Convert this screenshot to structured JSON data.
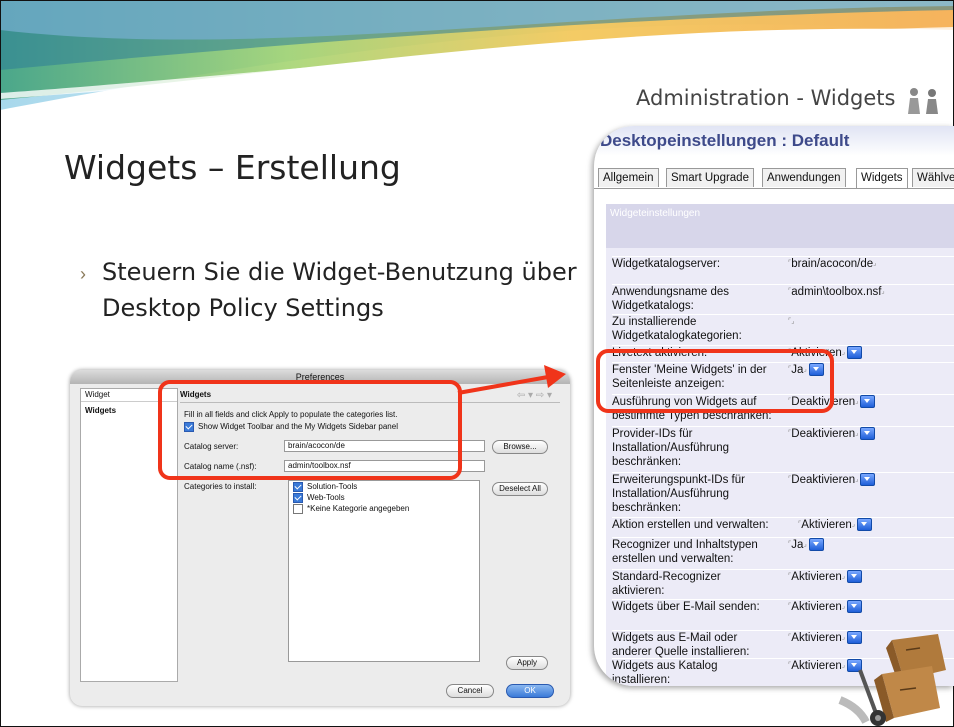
{
  "header": {
    "section_title": "Administration - Widgets",
    "people_icon": "people-icon"
  },
  "slide": {
    "title": "Widgets – Erstellung",
    "bullet": "Steuern Sie die Widget-Benutzung über Desktop Policy Settings"
  },
  "preferences": {
    "window_title": "Preferences",
    "left_header": "Widget",
    "left_item": "Widgets",
    "panel_title": "Widgets",
    "instructions": "Fill in all fields and click Apply to populate the categories list.",
    "show_toolbar_label": "Show Widget Toolbar and the My Widgets Sidebar panel",
    "show_toolbar_checked": true,
    "catalog_server_label": "Catalog server:",
    "catalog_server_value": "brain/acocon/de",
    "browse_label": "Browse...",
    "catalog_name_label": "Catalog name (.nsf):",
    "catalog_name_value": "admin/toolbox.nsf",
    "categories_label": "Categories to install:",
    "deselect_all_label": "Deselect All",
    "categories": [
      {
        "label": "Solution-Tools",
        "checked": true
      },
      {
        "label": "Web-Tools",
        "checked": true
      },
      {
        "label": "*Keine Kategorie angegeben",
        "checked": false
      }
    ],
    "apply_label": "Apply",
    "cancel_label": "Cancel",
    "ok_label": "OK"
  },
  "desktop": {
    "title": "Desktopeinstellungen : Default",
    "tabs": [
      "Allgemein",
      "Smart Upgrade",
      "Anwendungen",
      "Widgets",
      "Wählver"
    ],
    "active_tab": "Widgets",
    "section": "Widgeteinstellungen",
    "rows": [
      {
        "label": "Widgetkatalogserver:",
        "value": "brain/acocon/de",
        "dropdown": false
      },
      {
        "label": "Anwendungsname des Widgetkatalogs:",
        "value": "admin\\toolbox.nsf",
        "dropdown": false
      },
      {
        "label": "Zu installierende Widgetkatalogkategorien:",
        "value": "",
        "dropdown": false
      },
      {
        "label": "Livetext aktivieren:",
        "value": "Aktivieren",
        "dropdown": true
      },
      {
        "label": "Fenster 'Meine Widgets' in der Seitenleiste anzeigen:",
        "value": "Ja",
        "dropdown": true
      },
      {
        "label": "Ausführung von Widgets auf bestimmte Typen beschränken:",
        "value": "Deaktivieren",
        "dropdown": true
      },
      {
        "label": "Provider-IDs für Installation/Ausführung beschränken:",
        "value": "Deaktivieren",
        "dropdown": true
      },
      {
        "label": "Erweiterungspunkt-IDs für Installation/Ausführung beschränken:",
        "value": "Deaktivieren",
        "dropdown": true
      },
      {
        "label": "Aktion erstellen und verwalten:",
        "value": "Aktivieren",
        "dropdown": true
      },
      {
        "label": "Recognizer und Inhaltstypen erstellen und verwalten:",
        "value": "Ja",
        "dropdown": true
      },
      {
        "label": "Standard-Recognizer aktivieren:",
        "value": "Aktivieren",
        "dropdown": true
      },
      {
        "label": "Widgets über E-Mail senden:",
        "value": "Aktivieren",
        "dropdown": true
      },
      {
        "label": "Widgets aus E-Mail oder anderer Quelle installieren:",
        "value": "Aktivieren",
        "dropdown": true
      },
      {
        "label": "Widgets aus Katalog installieren:",
        "value": "Aktivieren",
        "dropdown": true
      }
    ]
  },
  "colors": {
    "highlight": "#f0341a",
    "dropdown": "#1f5fd8",
    "settings_bg": "#ecebf7"
  }
}
